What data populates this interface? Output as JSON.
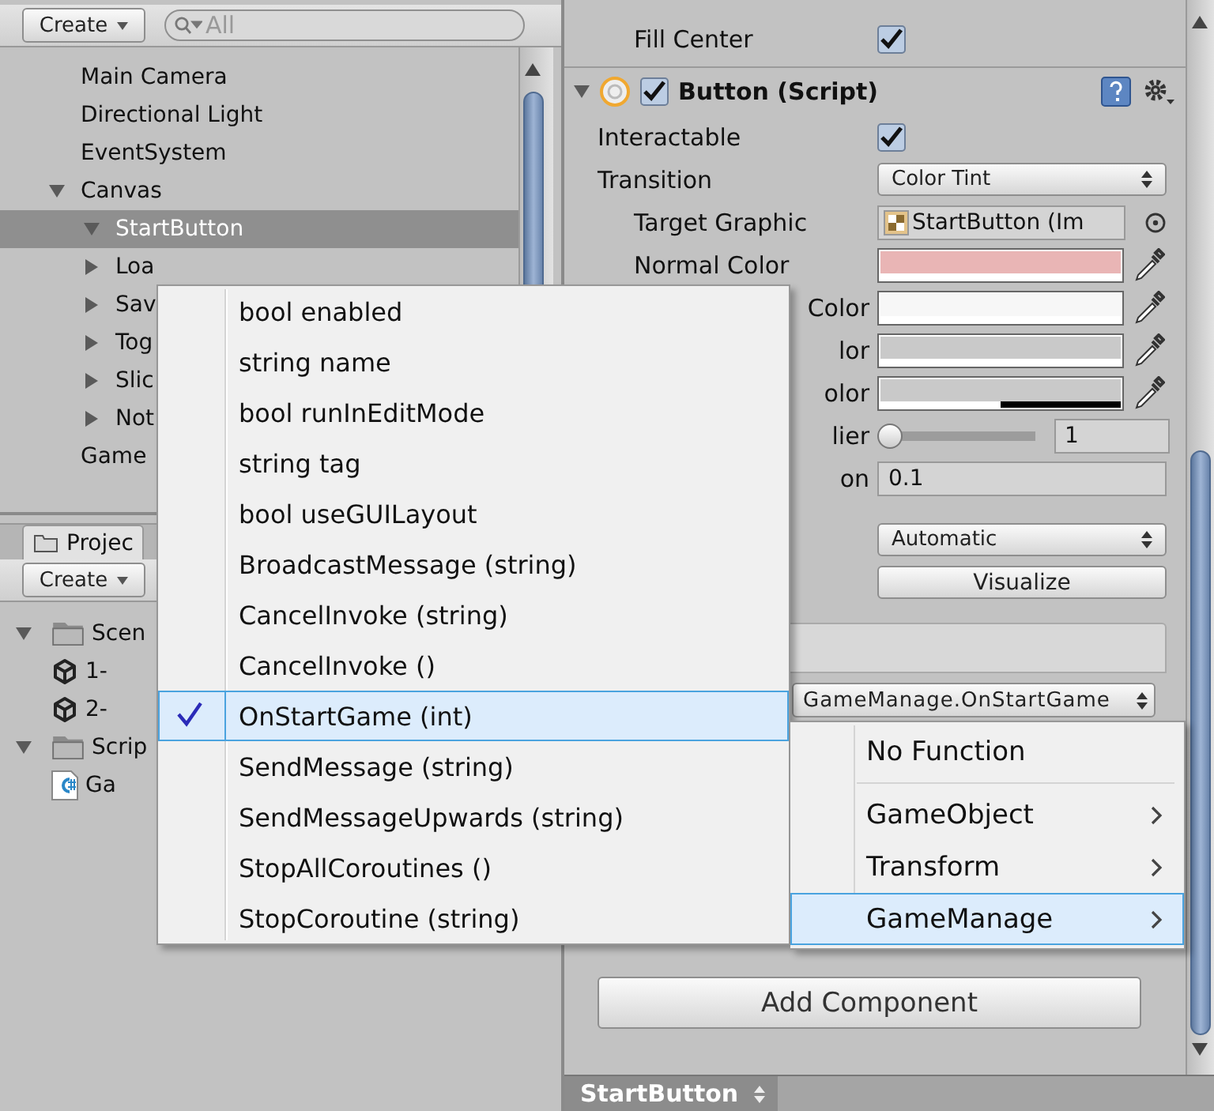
{
  "hierarchy": {
    "create_button": "Create",
    "search": {
      "placeholder": "All"
    },
    "items": [
      {
        "label": "Main Camera",
        "selected": false
      },
      {
        "label": "Directional Light",
        "selected": false
      },
      {
        "label": "EventSystem",
        "selected": false
      },
      {
        "label": "Canvas",
        "selected": false,
        "expanded": true,
        "children": [
          {
            "label": "StartButton",
            "selected": true,
            "expanded": true
          },
          {
            "label": "Loa",
            "selected": false,
            "expanded": false
          },
          {
            "label": "Sav",
            "selected": false,
            "expanded": false
          },
          {
            "label": "Tog",
            "selected": false,
            "expanded": false
          },
          {
            "label": "Slic",
            "selected": false,
            "expanded": false
          },
          {
            "label": "Not",
            "selected": false,
            "expanded": false
          }
        ]
      },
      {
        "label": "Game",
        "selected": false
      }
    ]
  },
  "project": {
    "tab": "Projec",
    "create_button": "Create",
    "items": [
      {
        "label": "Scen",
        "kind": "folder",
        "expanded": true,
        "children": [
          {
            "label": "1-",
            "kind": "scene"
          },
          {
            "label": "2-",
            "kind": "scene"
          }
        ]
      },
      {
        "label": "Scrip",
        "kind": "folder",
        "expanded": true,
        "children": [
          {
            "label": "Ga",
            "kind": "script"
          }
        ]
      }
    ]
  },
  "inspector": {
    "fill_center": {
      "label": "Fill Center",
      "checked": true
    },
    "component": {
      "title": "Button (Script)",
      "expanded": true,
      "enabled": true
    },
    "fields": [
      {
        "kind": "checkbox",
        "label": "Interactable",
        "checked": true
      },
      {
        "kind": "dropdown",
        "label": "Transition",
        "value": "Color Tint"
      },
      {
        "kind": "object",
        "label": "Target Graphic",
        "indent": true,
        "value": "StartButton (Im"
      },
      {
        "kind": "color",
        "label": "Normal Color",
        "indent": true,
        "color": "#e9b5b5",
        "level": 1
      },
      {
        "kind": "color",
        "label": "Color",
        "clipped": true,
        "color": "#f7f7f7",
        "level": 1
      },
      {
        "kind": "color",
        "label": "lor",
        "clipped": true,
        "color": "#c9c9c9",
        "level": 1
      },
      {
        "kind": "color",
        "label": "olor",
        "clipped": true,
        "color": "#c9c9c9",
        "level": 0.5
      },
      {
        "kind": "slider",
        "label": "lier",
        "clipped": true,
        "level": 0,
        "value": "1"
      },
      {
        "kind": "text",
        "label": "on",
        "clipped": true,
        "value": "0.1"
      },
      {
        "kind": "dropdown",
        "value": "Automatic"
      },
      {
        "kind": "button",
        "value": "Visualize"
      }
    ],
    "event": {
      "function": "GameManage.OnStartGame"
    },
    "add_component": "Add Component",
    "bottom_bar": {
      "object": "StartButton"
    }
  },
  "popup": {
    "items": [
      {
        "label": "bool enabled",
        "checked": false,
        "selected": false
      },
      {
        "label": "string name",
        "checked": false,
        "selected": false
      },
      {
        "label": "bool runInEditMode",
        "checked": false,
        "selected": false
      },
      {
        "label": "string tag",
        "checked": false,
        "selected": false
      },
      {
        "label": "bool useGUILayout",
        "checked": false,
        "selected": false
      },
      {
        "label": "BroadcastMessage (string)",
        "checked": false,
        "selected": false
      },
      {
        "label": "CancelInvoke (string)",
        "checked": false,
        "selected": false
      },
      {
        "label": "CancelInvoke ()",
        "checked": false,
        "selected": false
      },
      {
        "label": "OnStartGame (int)",
        "checked": true,
        "selected": true
      },
      {
        "label": "SendMessage (string)",
        "checked": false,
        "selected": false
      },
      {
        "label": "SendMessageUpwards (string)",
        "checked": false,
        "selected": false
      },
      {
        "label": "StopAllCoroutines ()",
        "checked": false,
        "selected": false
      },
      {
        "label": "StopCoroutine (string)",
        "checked": false,
        "selected": false
      }
    ]
  },
  "submenu": {
    "items": [
      {
        "label": "No Function",
        "kind": "action",
        "selected": false
      },
      {
        "label": "GameObject",
        "kind": "submenu",
        "selected": false
      },
      {
        "label": "Transform",
        "kind": "submenu",
        "selected": false
      },
      {
        "label": "GameManage",
        "kind": "submenu",
        "selected": true
      }
    ]
  }
}
